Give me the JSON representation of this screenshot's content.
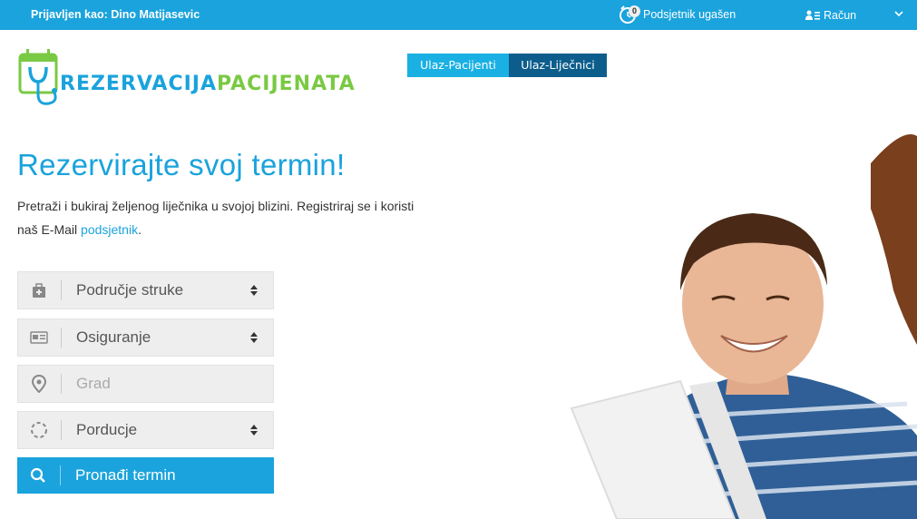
{
  "topbar": {
    "login_text": "Prijavljen kao: Dino Matijasevic",
    "reminder_count": "0",
    "reminder_text": "Podsjetnik ugašen",
    "account_label": "Račun",
    "bg_color": "#1aa3dc"
  },
  "logo": {
    "part1": "REZERVACIJA",
    "part2": "PACIJENATA",
    "icon": "calendar-stethoscope-icon"
  },
  "nav": {
    "patients_label": "Ulaz-Pacijenti",
    "doctors_label": "Ulaz-Liječnici"
  },
  "hero": {
    "headline": "Rezervirajte svoj termin!",
    "subline_before": "Pretraži i bukiraj željenog liječnika u svojoj blizini. Registriraj se i koristi naš E-Mail ",
    "subline_link": "podsjetnik",
    "subline_after": ".",
    "image": "smiling-man-with-laptop"
  },
  "form": {
    "specialty": {
      "value": "Područje struke",
      "icon": "medical-kit-icon"
    },
    "insurance": {
      "value": "Osiguranje",
      "icon": "id-card-icon"
    },
    "city": {
      "placeholder": "Grad",
      "icon": "map-pin-icon"
    },
    "area": {
      "value": "Porducje",
      "icon": "dashed-circle-icon"
    },
    "search_label": "Pronađi termin"
  },
  "colors": {
    "accent": "#1aa3dc",
    "dark_button": "#0d5d8c",
    "logo_green": "#7ac943"
  }
}
